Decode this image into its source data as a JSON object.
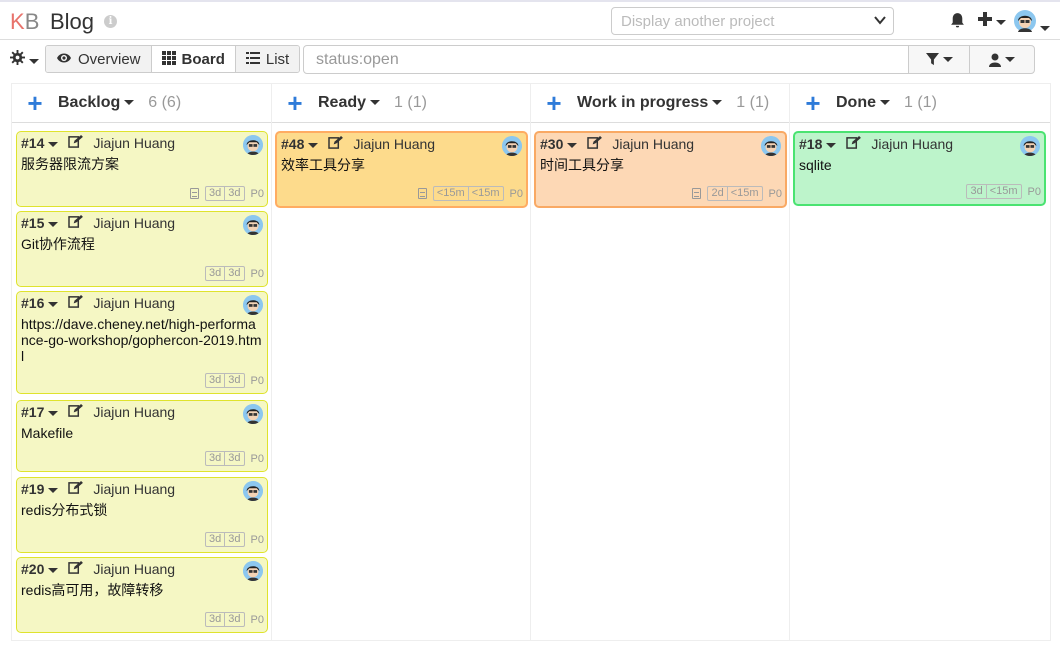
{
  "app": {
    "logo_k": "K",
    "logo_b": "B",
    "title": "Blog"
  },
  "project_select": {
    "placeholder": "Display another project"
  },
  "views": [
    {
      "label": "Overview",
      "icon": "eye-icon"
    },
    {
      "label": "Board",
      "icon": "grid-icon",
      "active": true
    },
    {
      "label": "List",
      "icon": "list-icon"
    }
  ],
  "search": {
    "value": "status:open"
  },
  "columns": [
    {
      "name": "Backlog",
      "count": "6 (6)",
      "cards": [
        {
          "id": "#14",
          "assignee": "Jiajun Huang",
          "title": "服务器限流方案",
          "has_desc": true,
          "est": [
            "3d",
            "3d"
          ],
          "priority": "P0",
          "color": "yellow"
        },
        {
          "id": "#15",
          "assignee": "Jiajun Huang",
          "title": "Git协作流程",
          "has_desc": false,
          "est": [
            "3d",
            "3d"
          ],
          "priority": "P0",
          "color": "yellow"
        },
        {
          "id": "#16",
          "assignee": "Jiajun Huang",
          "title": "https://dave.cheney.net/high-performance-go-workshop/gophercon-2019.html",
          "has_desc": false,
          "est": [
            "3d",
            "3d"
          ],
          "priority": "P0",
          "color": "yellow"
        },
        {
          "id": "#17",
          "assignee": "Jiajun Huang",
          "title": "Makefile",
          "has_desc": false,
          "est": [
            "3d",
            "3d"
          ],
          "priority": "P0",
          "color": "yellow"
        },
        {
          "id": "#19",
          "assignee": "Jiajun Huang",
          "title": "redis分布式锁",
          "has_desc": false,
          "est": [
            "3d",
            "3d"
          ],
          "priority": "P0",
          "color": "yellow"
        },
        {
          "id": "#20",
          "assignee": "Jiajun Huang",
          "title": "redis高可用，故障转移",
          "has_desc": false,
          "est": [
            "3d",
            "3d"
          ],
          "priority": "P0",
          "color": "yellow"
        }
      ]
    },
    {
      "name": "Ready",
      "count": "1 (1)",
      "cards": [
        {
          "id": "#48",
          "assignee": "Jiajun Huang",
          "title": "效率工具分享",
          "has_desc": true,
          "est": [
            "<15m",
            "<15m"
          ],
          "priority": "P0",
          "color": "orange"
        }
      ]
    },
    {
      "name": "Work in progress",
      "count": "1 (1)",
      "cards": [
        {
          "id": "#30",
          "assignee": "Jiajun Huang",
          "title": "时间工具分享",
          "has_desc": true,
          "est": [
            "2d",
            "<15m"
          ],
          "priority": "P0",
          "color": "peach"
        }
      ]
    },
    {
      "name": "Done",
      "count": "1 (1)",
      "cards": [
        {
          "id": "#18",
          "assignee": "Jiajun Huang",
          "title": "sqlite",
          "has_desc": false,
          "est": [
            "3d",
            "<15m"
          ],
          "priority": "P0",
          "color": "green"
        }
      ]
    }
  ]
}
